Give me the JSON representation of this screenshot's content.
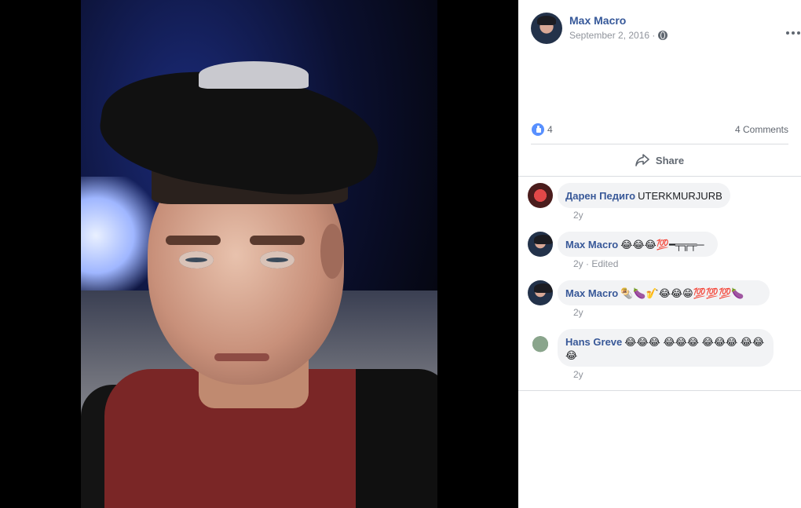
{
  "post": {
    "author": "Max Macro",
    "date": "September 2, 2016 ·",
    "like_count": "4",
    "comments_count": "4 Comments",
    "share_label": "Share"
  },
  "comments": [
    {
      "author": "Даpен Педиго",
      "text": "UTERKMURJURB",
      "time": "2y"
    },
    {
      "author": "Max Macro",
      "text": "😂😂😂💯━╤╦╤─",
      "time": "2y · Edited"
    },
    {
      "author": "Max Macro",
      "text": "🌯🍆🎷😂😂😁💯💯💯🍆",
      "time": "2y"
    },
    {
      "author": "Hans Greve",
      "text": "😂😂😂 😂😂😂 😂😂😂 😂😂😂",
      "time": "2y"
    }
  ],
  "icons": {
    "globe": "globe-icon",
    "more": "more-options-icon",
    "like": "like-icon",
    "share": "share-icon"
  },
  "colors": {
    "link": "#365899",
    "like": "#5890ff",
    "bubble": "#f2f3f5"
  }
}
